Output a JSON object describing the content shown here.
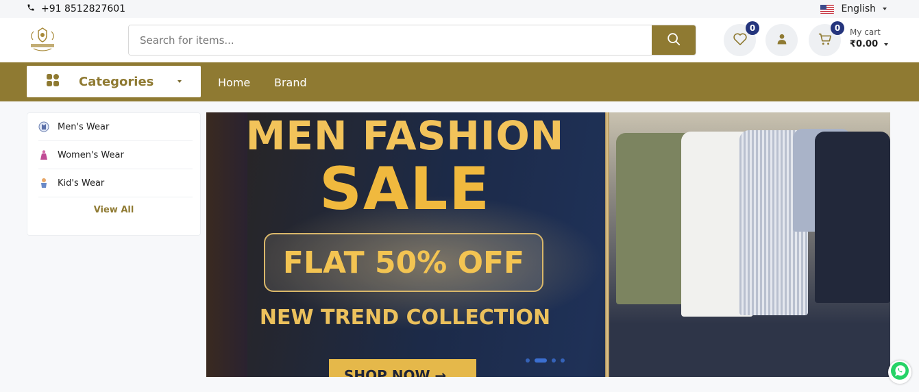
{
  "topbar": {
    "phone": "+91 8512827601",
    "phone_icon": "phone-icon",
    "language": "English",
    "flag_icon": "us-flag-icon"
  },
  "header": {
    "logo_alt": "logo",
    "search_placeholder": "Search for items...",
    "wishlist_count": "0",
    "cart_count": "0",
    "cart_label": "My cart",
    "cart_amount": "₹0.00"
  },
  "nav": {
    "categories_label": "Categories",
    "links": [
      "Home",
      "Brand"
    ]
  },
  "sidebar": {
    "items": [
      {
        "label": "Men's Wear",
        "icon": "mens-wear-icon"
      },
      {
        "label": "Women's Wear",
        "icon": "womens-wear-icon"
      },
      {
        "label": "Kid's Wear",
        "icon": "kids-wear-icon"
      }
    ],
    "view_all": "View All"
  },
  "banner": {
    "line1": "MEN FASHION",
    "line2": "SALE",
    "offer": "FLAT 50% OFF",
    "subline": "NEW TREND COLLECTION",
    "cta": "SHOP NOW →",
    "slides": 4,
    "active_slide": 2
  },
  "colors": {
    "brand": "#8f7a32",
    "badge": "#25357d"
  }
}
